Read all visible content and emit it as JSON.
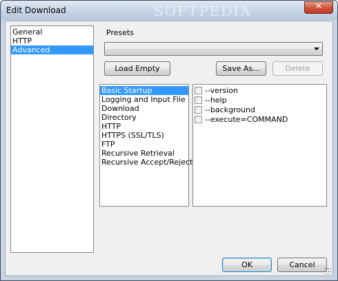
{
  "window": {
    "title": "Edit Download",
    "watermark": "SOFTPEDIA",
    "close_glyph": "✕"
  },
  "categories": {
    "items": [
      {
        "label": "General",
        "selected": false
      },
      {
        "label": "HTTP",
        "selected": false
      },
      {
        "label": "Advanced",
        "selected": true
      }
    ]
  },
  "presets": {
    "label": "Presets",
    "selected_value": "",
    "load_empty_label": "Load Empty",
    "save_as_label": "Save As...",
    "delete_label": "Delete"
  },
  "option_groups": {
    "items": [
      {
        "label": "Basic Startup",
        "selected": true
      },
      {
        "label": "Logging and Input File",
        "selected": false
      },
      {
        "label": "Download",
        "selected": false
      },
      {
        "label": "Directory",
        "selected": false
      },
      {
        "label": "HTTP",
        "selected": false
      },
      {
        "label": "HTTPS (SSL/TLS)",
        "selected": false
      },
      {
        "label": "FTP",
        "selected": false
      },
      {
        "label": "Recursive Retrieval",
        "selected": false
      },
      {
        "label": "Recursive Accept/Reject",
        "selected": false
      }
    ]
  },
  "options": {
    "items": [
      {
        "label": "--version",
        "checked": false
      },
      {
        "label": "--help",
        "checked": false
      },
      {
        "label": "--background",
        "checked": false
      },
      {
        "label": "--execute=COMMAND",
        "checked": false
      }
    ]
  },
  "footer": {
    "ok_label": "OK",
    "cancel_label": "Cancel"
  },
  "colors": {
    "selection": "#3399ff",
    "close_button": "#c13a24",
    "window_frame": "#c9d3e2"
  }
}
